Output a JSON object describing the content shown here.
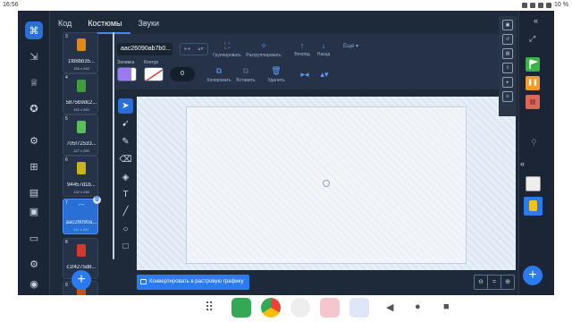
{
  "status": {
    "time": "16:56",
    "battery": "10 %"
  },
  "tabs": [
    {
      "label": "Код"
    },
    {
      "label": "Костюмы"
    },
    {
      "label": "Звуки"
    }
  ],
  "costumes": [
    {
      "num": "3",
      "name": "1f88bb35...",
      "size": "156 x 263",
      "sprite_color": "#e0891a"
    },
    {
      "num": "4",
      "name": "5875b9dc2...",
      "size": "152 x 263",
      "sprite_color": "#3f9e3a"
    },
    {
      "num": "5",
      "name": "705f72533...",
      "size": "127 x 259",
      "sprite_color": "#5bbf57"
    },
    {
      "num": "6",
      "name": "94457d1b...",
      "size": "132 x 248",
      "sprite_color": "#c9b21c"
    },
    {
      "num": "7",
      "name": "aac26090a...",
      "size": "111 x 224",
      "sprite_color": "#2a7bf0"
    },
    {
      "num": "8",
      "name": "c1f4275d8...",
      "size": "162 x 262",
      "sprite_color": "#d43a2a"
    },
    {
      "num": "9",
      "name": "",
      "size": "",
      "sprite_color": "#c8521d"
    }
  ],
  "editor": {
    "costume_name": "aac26090ab7b0...",
    "group_label": "Группировать",
    "ungroup_label": "Разгруппировать",
    "forward_label": "Вперёд",
    "back_label": "Назад",
    "more_label": "Ещё",
    "fill_label": "Заливка",
    "outline_label": "Контур",
    "stroke_width": "0",
    "copy_label": "Копировать",
    "paste_label": "Вставить",
    "delete_label": "Удалить",
    "convert_label": "Конвертировать в растровую графику"
  },
  "colors": {
    "fill": "#9b7cf0",
    "accent": "#2a7bf0"
  }
}
